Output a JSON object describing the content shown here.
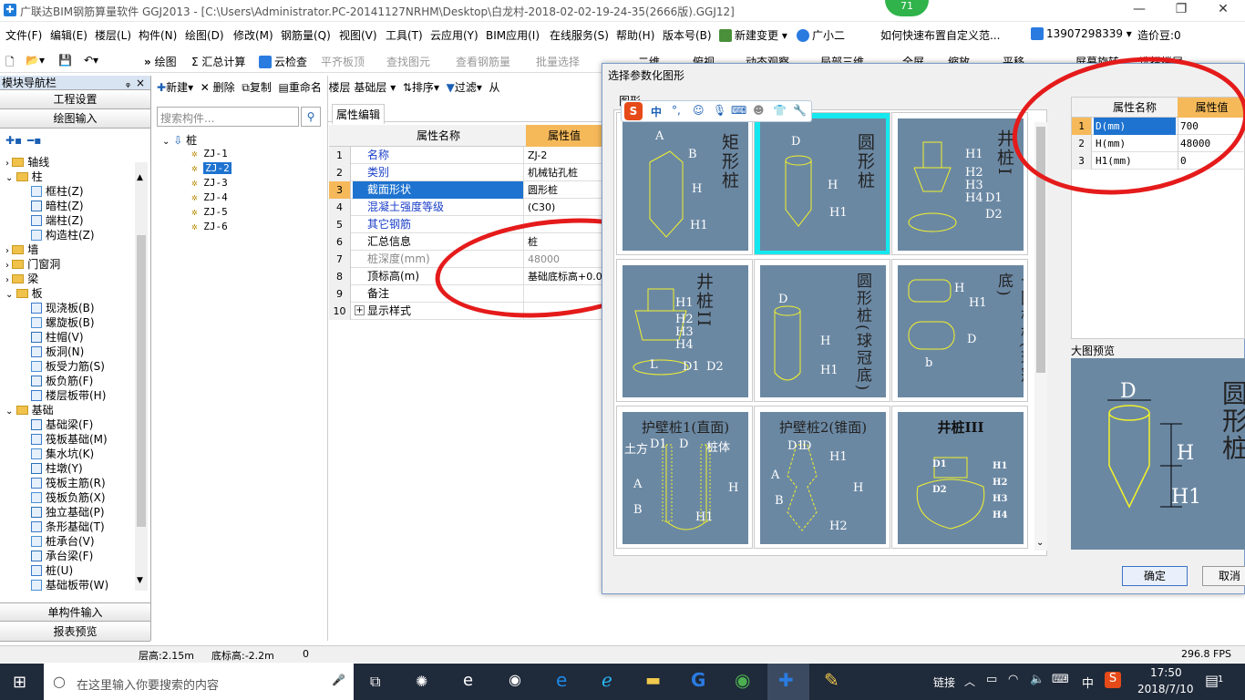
{
  "window": {
    "title": "广联达BIM钢筋算量软件 GGJ2013 - [C:\\Users\\Administrator.PC-20141127NRHM\\Desktop\\白龙村-2018-02-02-19-24-35(2666版).GGJ12]",
    "badge": "71",
    "min": "—",
    "restore": "❐",
    "close": "✕"
  },
  "menu": [
    "文件(F)",
    "编辑(E)",
    "楼层(L)",
    "构件(N)",
    "绘图(D)",
    "修改(M)",
    "钢筋量(Q)",
    "视图(V)",
    "工具(T)",
    "云应用(Y)",
    "BIM应用(I)",
    "在线服务(S)",
    "帮助(H)",
    "版本号(B)",
    "新建变更",
    "广小二",
    "如何快速布置自定义范...",
    "13907298339",
    "造价豆:0"
  ],
  "toolbar": [
    "绘图",
    "Σ 汇总计算",
    "云检查",
    "平齐板顶",
    "查找图元",
    "查看钢筋量",
    "批量选择",
    "二维",
    "俯视",
    "动态观察",
    "局部三维",
    "全屏",
    "缩放",
    "平移",
    "屏幕旋转",
    "选择楼层"
  ],
  "nav": {
    "title": "模块导航栏",
    "pin": "ᵩ",
    "close": "×",
    "btn_project": "工程设置",
    "btn_draw": "绘图输入",
    "btn_single": "单构件输入",
    "btn_report": "报表预览",
    "tree": [
      {
        "t": "轴线",
        "lv": 0,
        "exp": "›",
        "f": 1
      },
      {
        "t": "柱",
        "lv": 0,
        "exp": "⌄",
        "f": 1
      },
      {
        "t": "框柱(Z)",
        "lv": 1
      },
      {
        "t": "暗柱(Z)",
        "lv": 1
      },
      {
        "t": "端柱(Z)",
        "lv": 1
      },
      {
        "t": "构造柱(Z)",
        "lv": 1
      },
      {
        "t": "墙",
        "lv": 0,
        "exp": "›",
        "f": 1
      },
      {
        "t": "门窗洞",
        "lv": 0,
        "exp": "›",
        "f": 1
      },
      {
        "t": "梁",
        "lv": 0,
        "exp": "›",
        "f": 1
      },
      {
        "t": "板",
        "lv": 0,
        "exp": "⌄",
        "f": 1
      },
      {
        "t": "现浇板(B)",
        "lv": 1
      },
      {
        "t": "螺旋板(B)",
        "lv": 1
      },
      {
        "t": "柱帽(V)",
        "lv": 1
      },
      {
        "t": "板洞(N)",
        "lv": 1
      },
      {
        "t": "板受力筋(S)",
        "lv": 1
      },
      {
        "t": "板负筋(F)",
        "lv": 1
      },
      {
        "t": "楼层板带(H)",
        "lv": 1
      },
      {
        "t": "基础",
        "lv": 0,
        "exp": "⌄",
        "f": 1
      },
      {
        "t": "基础梁(F)",
        "lv": 1
      },
      {
        "t": "筏板基础(M)",
        "lv": 1
      },
      {
        "t": "集水坑(K)",
        "lv": 1
      },
      {
        "t": "柱墩(Y)",
        "lv": 1
      },
      {
        "t": "筏板主筋(R)",
        "lv": 1
      },
      {
        "t": "筏板负筋(X)",
        "lv": 1
      },
      {
        "t": "独立基础(P)",
        "lv": 1
      },
      {
        "t": "条形基础(T)",
        "lv": 1
      },
      {
        "t": "桩承台(V)",
        "lv": 1
      },
      {
        "t": "承台梁(F)",
        "lv": 1
      },
      {
        "t": "桩(U)",
        "lv": 1
      },
      {
        "t": "基础板带(W)",
        "lv": 1
      }
    ]
  },
  "mid": {
    "toolbar": [
      "新建",
      "删除",
      "复制",
      "重命名",
      "楼层",
      "基础层",
      "排序",
      "过滤",
      "从"
    ],
    "search_placeholder": "搜索构件...",
    "root": "桩",
    "items": [
      "ZJ-1",
      "ZJ-2",
      "ZJ-3",
      "ZJ-4",
      "ZJ-5",
      "ZJ-6"
    ],
    "selected": 1
  },
  "props": {
    "tab": "属性编辑",
    "h_name": "属性名称",
    "h_val": "属性值",
    "rows": [
      {
        "n": "1",
        "k": "名称",
        "v": "ZJ-2",
        "blue": true
      },
      {
        "n": "2",
        "k": "类别",
        "v": "机械钻孔桩",
        "blue": true
      },
      {
        "n": "3",
        "k": "截面形状",
        "v": "圆形桩",
        "blue": true,
        "sel": true
      },
      {
        "n": "4",
        "k": "混凝土强度等级",
        "v": "(C30)",
        "blue": true
      },
      {
        "n": "5",
        "k": "其它钢筋",
        "v": "",
        "blue": true
      },
      {
        "n": "6",
        "k": "汇总信息",
        "v": "桩"
      },
      {
        "n": "7",
        "k": "桩深度(mm)",
        "v": "48000",
        "gray": true
      },
      {
        "n": "8",
        "k": "顶标高(m)",
        "v": "基础底标高+0.0"
      },
      {
        "n": "9",
        "k": "备注",
        "v": ""
      },
      {
        "n": "10",
        "k": "显示样式",
        "v": "",
        "plus": "+"
      }
    ]
  },
  "dialog": {
    "title": "选择参数化图形",
    "group": "图形",
    "cards": [
      {
        "name": "矩形桩",
        "labels": [
          "A",
          "B",
          "H",
          "H1"
        ]
      },
      {
        "name": "圆形桩",
        "labels": [
          "D",
          "H",
          "H1"
        ]
      },
      {
        "name": "井桩I",
        "labels": [
          "H1",
          "H2",
          "H3",
          "H4",
          "D1",
          "D2"
        ]
      },
      {
        "name": "井桩II",
        "labels": [
          "H1",
          "H2",
          "H3",
          "H4",
          "D1",
          "D2",
          "L"
        ]
      },
      {
        "name": "圆形桩(球冠底)",
        "labels": [
          "D",
          "H",
          "H1"
        ]
      },
      {
        "name": "长圆柱桩(球冠底)",
        "labels": [
          "H",
          "H1",
          "D",
          "b"
        ]
      },
      {
        "name": "护壁桩1(直面)",
        "labels": [
          "土方",
          "D1",
          "D",
          "桩体",
          "A",
          "B",
          "H",
          "H1"
        ]
      },
      {
        "name": "护壁桩2(锥面)",
        "labels": [
          "D1",
          "D",
          "A",
          "B",
          "H1",
          "H",
          "H2"
        ]
      },
      {
        "name": "井桩III",
        "labels": [
          "D1",
          "D2",
          "H1",
          "H2",
          "H3",
          "H4"
        ]
      }
    ],
    "params": {
      "h_name": "属性名称",
      "h_val": "属性值",
      "rows": [
        {
          "n": "1",
          "k": "D(mm)",
          "v": "700"
        },
        {
          "n": "2",
          "k": "H(mm)",
          "v": "48000"
        },
        {
          "n": "3",
          "k": "H1(mm)",
          "v": "0"
        }
      ]
    },
    "preview_title": "大图预览",
    "preview_name": "圆形桩",
    "preview_labels": [
      "D",
      "H",
      "H1"
    ],
    "ok": "确定",
    "cancel": "取消"
  },
  "status": {
    "floor_h": "层高:2.15m",
    "bottom": "底标高:-2.2m",
    "zero": "0",
    "fps": "296.8 FPS"
  },
  "taskbar": {
    "search": "在这里输入你要搜索的内容",
    "link": "链接",
    "ime": "中",
    "time": "17:50",
    "date": "2018/7/10",
    "notif": "1"
  },
  "colors": {
    "accent": "#3a73c8",
    "selection": "#1e73d0",
    "ellipse": "#e51b1b",
    "imgbg": "#6b88a3",
    "cyan": "#14e8ee"
  }
}
